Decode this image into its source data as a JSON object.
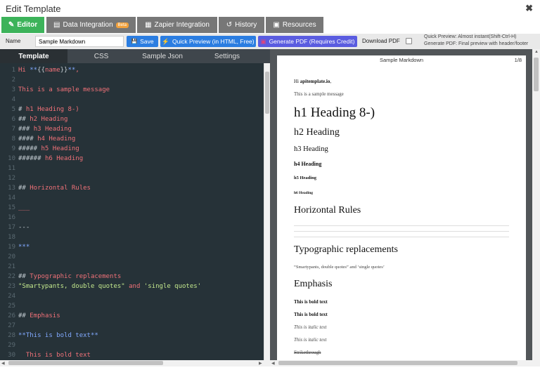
{
  "window": {
    "title": "Edit Template",
    "close_glyph": "✖"
  },
  "tabs": [
    {
      "label": "Editor",
      "icon": "✎",
      "active": true
    },
    {
      "label": "Data Integration",
      "icon": "▤",
      "badge": "Beta"
    },
    {
      "label": "Zapier Integration",
      "icon": "▦"
    },
    {
      "label": "History",
      "icon": "↺"
    },
    {
      "label": "Resources",
      "icon": "▣"
    }
  ],
  "toolbar": {
    "name_label": "Name",
    "name_value": "Sample Markdown",
    "save_label": "Save",
    "save_icon": "💾",
    "quick_preview_label": "Quick Preview (in HTML, Free)",
    "quick_preview_icon": "⚡",
    "generate_pdf_label": "Generate PDF (Requires Credit)",
    "generate_pdf_icon": "▣",
    "download_pdf_label": "Download PDF",
    "hint_quick": "Quick Preview: Almost instant(Shift-Ctrl-H)",
    "hint_generate": "Generate PDF: Final preview with header/footer"
  },
  "subtabs": [
    "Template",
    "CSS",
    "Sample Json",
    "Settings"
  ],
  "editor": {
    "line_numbers": [
      "1",
      "2",
      "3",
      "4",
      "5",
      "6",
      "7",
      "8",
      "9",
      "10",
      "11",
      "12",
      "13",
      "14",
      "15",
      "16",
      "17",
      "18",
      "19",
      "20",
      "21",
      "22",
      "23",
      "24",
      "25",
      "26",
      "27",
      "28",
      "29",
      "30"
    ],
    "lines": [
      [
        [
          "Hi ",
          "r"
        ],
        [
          "**",
          "b"
        ],
        [
          "{{",
          "w"
        ],
        [
          "name",
          "r"
        ],
        [
          "}}",
          "w"
        ],
        [
          "**",
          "b"
        ],
        [
          ",",
          "r"
        ]
      ],
      [],
      [
        [
          "This is a sample message",
          "r"
        ]
      ],
      [],
      [
        [
          "# ",
          "w"
        ],
        [
          "h1 Heading 8-)",
          "r"
        ]
      ],
      [
        [
          "## ",
          "w"
        ],
        [
          "h2 Heading",
          "r"
        ]
      ],
      [
        [
          "### ",
          "w"
        ],
        [
          "h3 Heading",
          "r"
        ]
      ],
      [
        [
          "#### ",
          "w"
        ],
        [
          "h4 Heading",
          "r"
        ]
      ],
      [
        [
          "##### ",
          "w"
        ],
        [
          "h5 Heading",
          "r"
        ]
      ],
      [
        [
          "###### ",
          "w"
        ],
        [
          "h6 Heading",
          "r"
        ]
      ],
      [],
      [],
      [
        [
          "## ",
          "w"
        ],
        [
          "Horizontal Rules",
          "r"
        ]
      ],
      [],
      [
        [
          "___",
          "r"
        ]
      ],
      [],
      [
        [
          "---",
          "w"
        ]
      ],
      [],
      [
        [
          "***",
          "b"
        ]
      ],
      [],
      [],
      [
        [
          "## ",
          "w"
        ],
        [
          "Typographic replacements",
          "r"
        ]
      ],
      [
        [
          "\"Smartypants, double quotes\"",
          "g"
        ],
        [
          " and ",
          "r"
        ],
        [
          "'single quotes'",
          "g"
        ]
      ],
      [],
      [],
      [
        [
          "## ",
          "w"
        ],
        [
          "Emphasis",
          "r"
        ]
      ],
      [],
      [
        [
          "**This is bold text**",
          "b"
        ]
      ],
      [],
      [
        [
          "  This is bold text",
          "r"
        ]
      ]
    ]
  },
  "preview": {
    "title": "Sample Markdown",
    "page_num": "1/8",
    "greeting_prefix": "Hi ",
    "greeting_name": "apitemplate.io",
    "greeting_suffix": ",",
    "message": "This is a sample message",
    "h1": "h1 Heading 8-)",
    "h2": "h2 Heading",
    "h3": "h3 Heading",
    "h4": "h4 Heading",
    "h5": "h5 Heading",
    "h6": "h6 Heading",
    "hr_heading": "Horizontal Rules",
    "typo_heading": "Typographic replacements",
    "typo_text": "“Smartypants, double quotes” and ‘single quotes’",
    "emphasis_heading": "Emphasis",
    "bold1": "This is bold text",
    "bold2": "This is bold text",
    "italic1": "This is italic text",
    "italic2": "This is italic text",
    "strike": "Strikethrough"
  }
}
